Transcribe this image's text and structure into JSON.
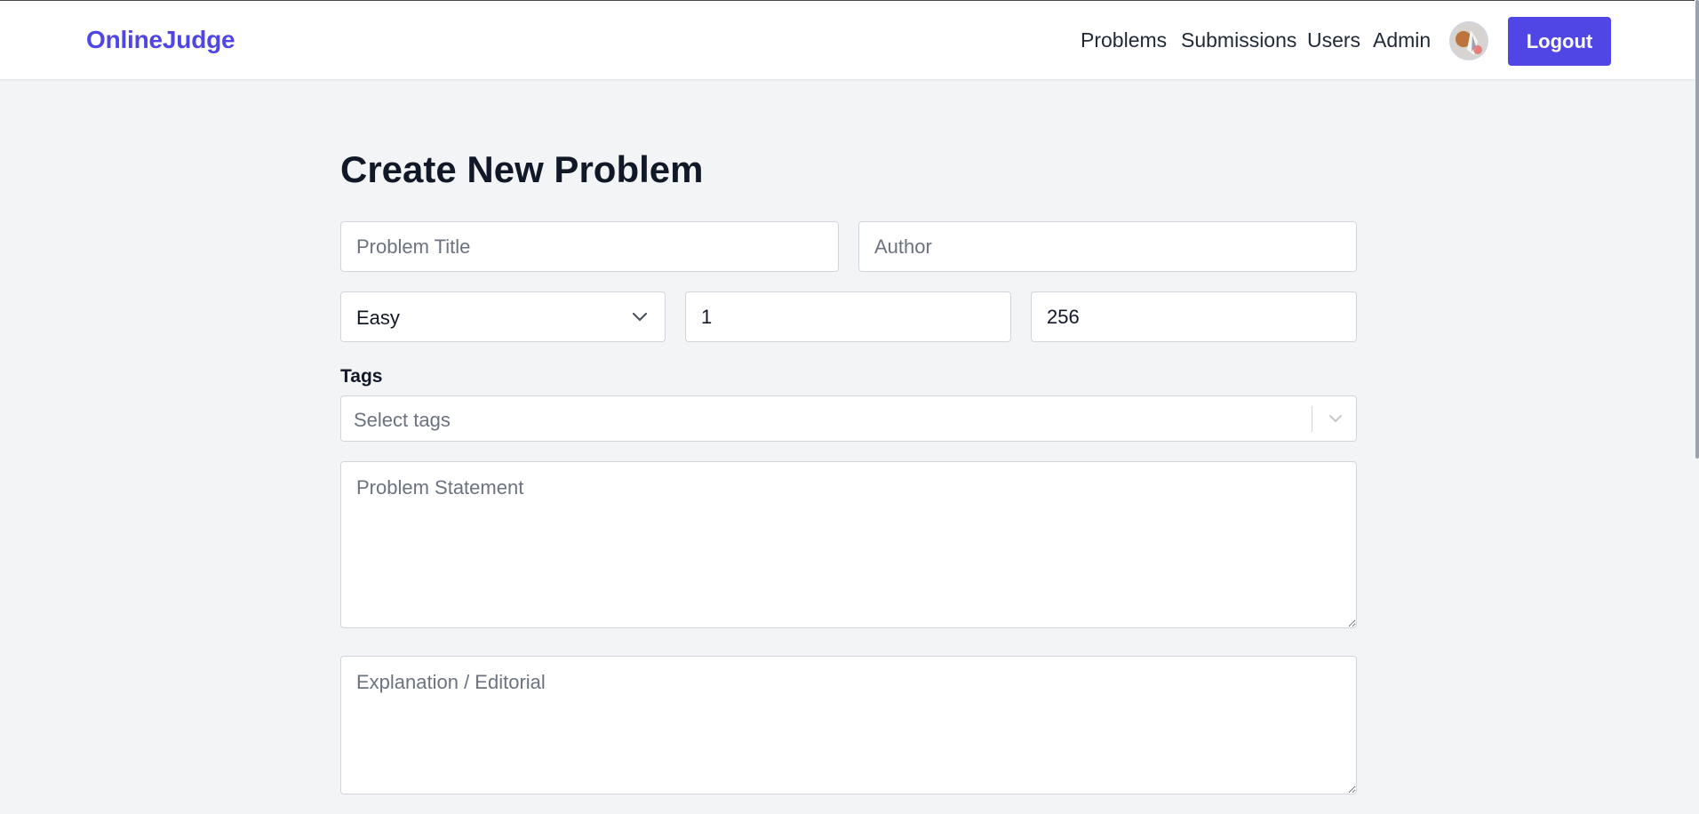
{
  "header": {
    "brand": "OnlineJudge",
    "nav": [
      "Problems",
      "Submissions",
      "Users",
      "Admin"
    ],
    "logout_label": "Logout",
    "avatar_alt": "User avatar",
    "accent": "#4f46e5"
  },
  "form": {
    "title": "Create New Problem",
    "problem_title_placeholder": "Problem Title",
    "author_placeholder": "Author",
    "difficulty": {
      "selected": "Easy"
    },
    "time_limit_value": "1",
    "memory_limit_value": "256",
    "tags": {
      "label": "Tags",
      "placeholder": "Select tags"
    },
    "statement_placeholder": "Problem Statement",
    "editorial_placeholder": "Explanation / Editorial"
  }
}
